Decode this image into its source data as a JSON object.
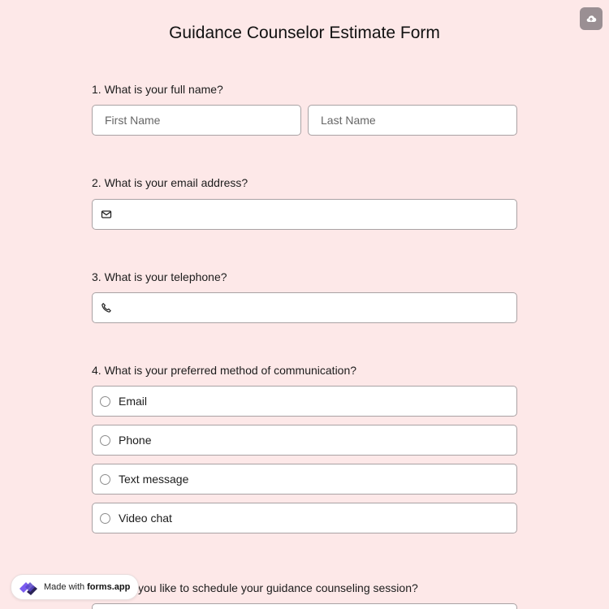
{
  "form": {
    "title": "Guidance Counselor Estimate Form"
  },
  "questions": {
    "q1": {
      "label": "1.  What is your full name?",
      "first_placeholder": "First Name",
      "last_placeholder": "Last Name"
    },
    "q2": {
      "label": "2. What is your email address?",
      "icon": "envelope-icon"
    },
    "q3": {
      "label": "3. What is your telephone?",
      "icon": "phone-icon"
    },
    "q4": {
      "label": "4. What is your preferred method of communication?",
      "options": [
        "Email",
        "Phone",
        "Text message",
        "Video chat"
      ]
    },
    "q5": {
      "label": "you like to schedule your guidance counseling session?"
    }
  },
  "badge": {
    "made_with": "Made with",
    "brand": "forms.app"
  },
  "toolbar": {
    "save_icon": "cloud-upload-icon"
  },
  "colors": {
    "background": "#fde8e8",
    "field_border": "#a9a2a4",
    "save_button": "#9a8f93",
    "brand_purple": "#7b5cf0"
  }
}
